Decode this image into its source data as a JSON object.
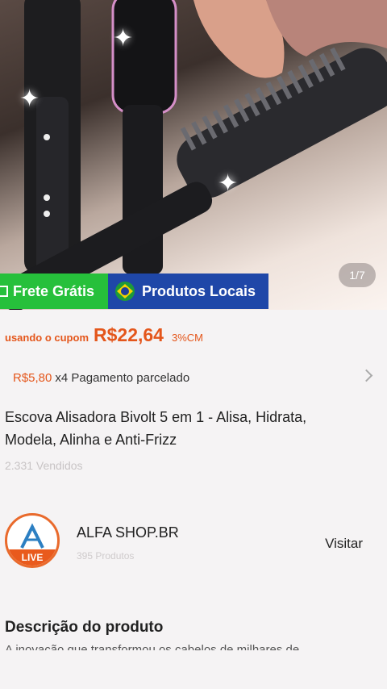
{
  "hero": {
    "image_counter": "1/7",
    "tag_free_shipping": "Frete Grátis",
    "tag_local_products": "Produtos Locais"
  },
  "price": {
    "coupon_label": "usando o cupom",
    "value": "R$22,64",
    "cashback": "3%CM"
  },
  "installment": {
    "amount": "R$5,80",
    "text": "x4 Pagamento parcelado"
  },
  "product": {
    "title": "Escova Alisadora Bivolt 5 em 1 - Alisa, Hidrata, Modela, Alinha e Anti-Frizz",
    "sold": "2.331 Vendidos"
  },
  "store": {
    "name": "ALFA SHOP.BR",
    "subtitle": "395 Produtos",
    "live_label": "LIVE",
    "visit_label": "Visitar"
  },
  "description": {
    "title": "Descrição do produto",
    "snippet": "A inovação que transformou os cabelos de milhares de"
  },
  "colors": {
    "accent": "#e4561b",
    "free_shipping_bg": "#26c03b",
    "local_products_bg": "#1f47a8"
  }
}
